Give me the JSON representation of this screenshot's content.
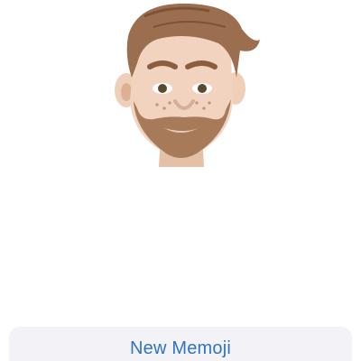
{
  "screen": {
    "background": "#ffffff"
  },
  "avatar": {
    "icon": "memoji-avatar",
    "description_visible": false
  },
  "action": {
    "label": "New Memoji",
    "color": "#2f74c4",
    "background": "#f2f2f7"
  }
}
